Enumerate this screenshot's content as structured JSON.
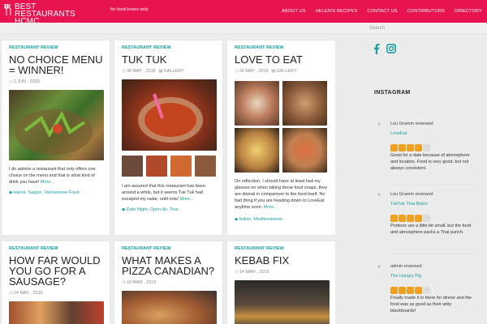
{
  "site": {
    "title": "BEST RESTAURANTS HCMC",
    "tagline": "for food lovers only",
    "logo_icon": "fork-knife-icon"
  },
  "nav": [
    "ABOUT US",
    "HELEN'S RECIPES",
    "CONTACT US",
    "CONTRIBUTORS",
    "DIRECTORY"
  ],
  "search": {
    "placeholder": "Search"
  },
  "posts": [
    {
      "category": "RESTAURANT REVIEW",
      "title": "NO CHOICE MENU = WINNER!",
      "date": "2 JUN , 2015",
      "extra": "",
      "excerpt": "I do admire a restaurant that only offers one choice on the menu and that is what kind of drink you have!",
      "more": "More...",
      "tags": "Hanoi, Saigon, Vietnamese Food"
    },
    {
      "category": "RESTAURANT REVIEW",
      "title": "TUK TUK",
      "date": "30 MAY , 2015",
      "extra": "GALLERY",
      "excerpt": "I am assured that this restaurant has been around a while, but it seems Tuk Tuk had escaped my radar, until now!",
      "more": "More...",
      "tags": "Date Night, Open Air, Thai"
    },
    {
      "category": "RESTAURANT REVIEW",
      "title": "LOVE TO EAT",
      "date": "26 MAY , 2015",
      "extra": "GALLERY",
      "excerpt": "On reflection, I should have at least had my glasses on when taking these food snaps, they are dismal in comparison to the food itself. No bad thing if you are heading down to LoveEat anytime soon.",
      "more": "More...",
      "tags": "Italian, Mediterranean"
    },
    {
      "category": "RESTAURANT REVIEW",
      "title": "HOW FAR WOULD YOU GO FOR A SAUSAGE?",
      "date": "24 MAY , 2015",
      "extra": "",
      "excerpt": "",
      "more": "",
      "tags": ""
    },
    {
      "category": "RESTAURANT REVIEW",
      "title": "WHAT MAKES A PIZZA CANADIAN?",
      "date": "19 MAR , 2015",
      "extra": "",
      "excerpt": "",
      "more": "",
      "tags": ""
    },
    {
      "category": "RESTAURANT REVIEW",
      "title": "KEBAB FIX",
      "date": "14 MAR , 2015",
      "extra": "",
      "excerpt": "",
      "more": "",
      "tags": ""
    }
  ],
  "sidebar": {
    "instagram_title": "INSTAGRAM",
    "social": [
      "facebook-icon",
      "instagram-icon"
    ],
    "reviews": [
      {
        "by": "Lou Gramm reviewed",
        "place": "LoveEat",
        "rating": 4,
        "text": "Great for a date because of atmosphere and location. Food is very good, but not always consistent."
      },
      {
        "by": "Lou Gramm reviewed",
        "place": "TukTuk Thai Bistro",
        "rating": 4,
        "text": "Portions are a little bit small, but the food and atmosphere packs a Thai punch."
      },
      {
        "by": "admin reviewed",
        "place": "The Hungry Pig",
        "rating": 4,
        "text": "Finally made it in there for dinner and the food was as good as their witty blackboards!"
      }
    ]
  },
  "colors": {
    "brand": "#e8144f",
    "accent": "#1aa0a0",
    "star": "#f0a020"
  }
}
